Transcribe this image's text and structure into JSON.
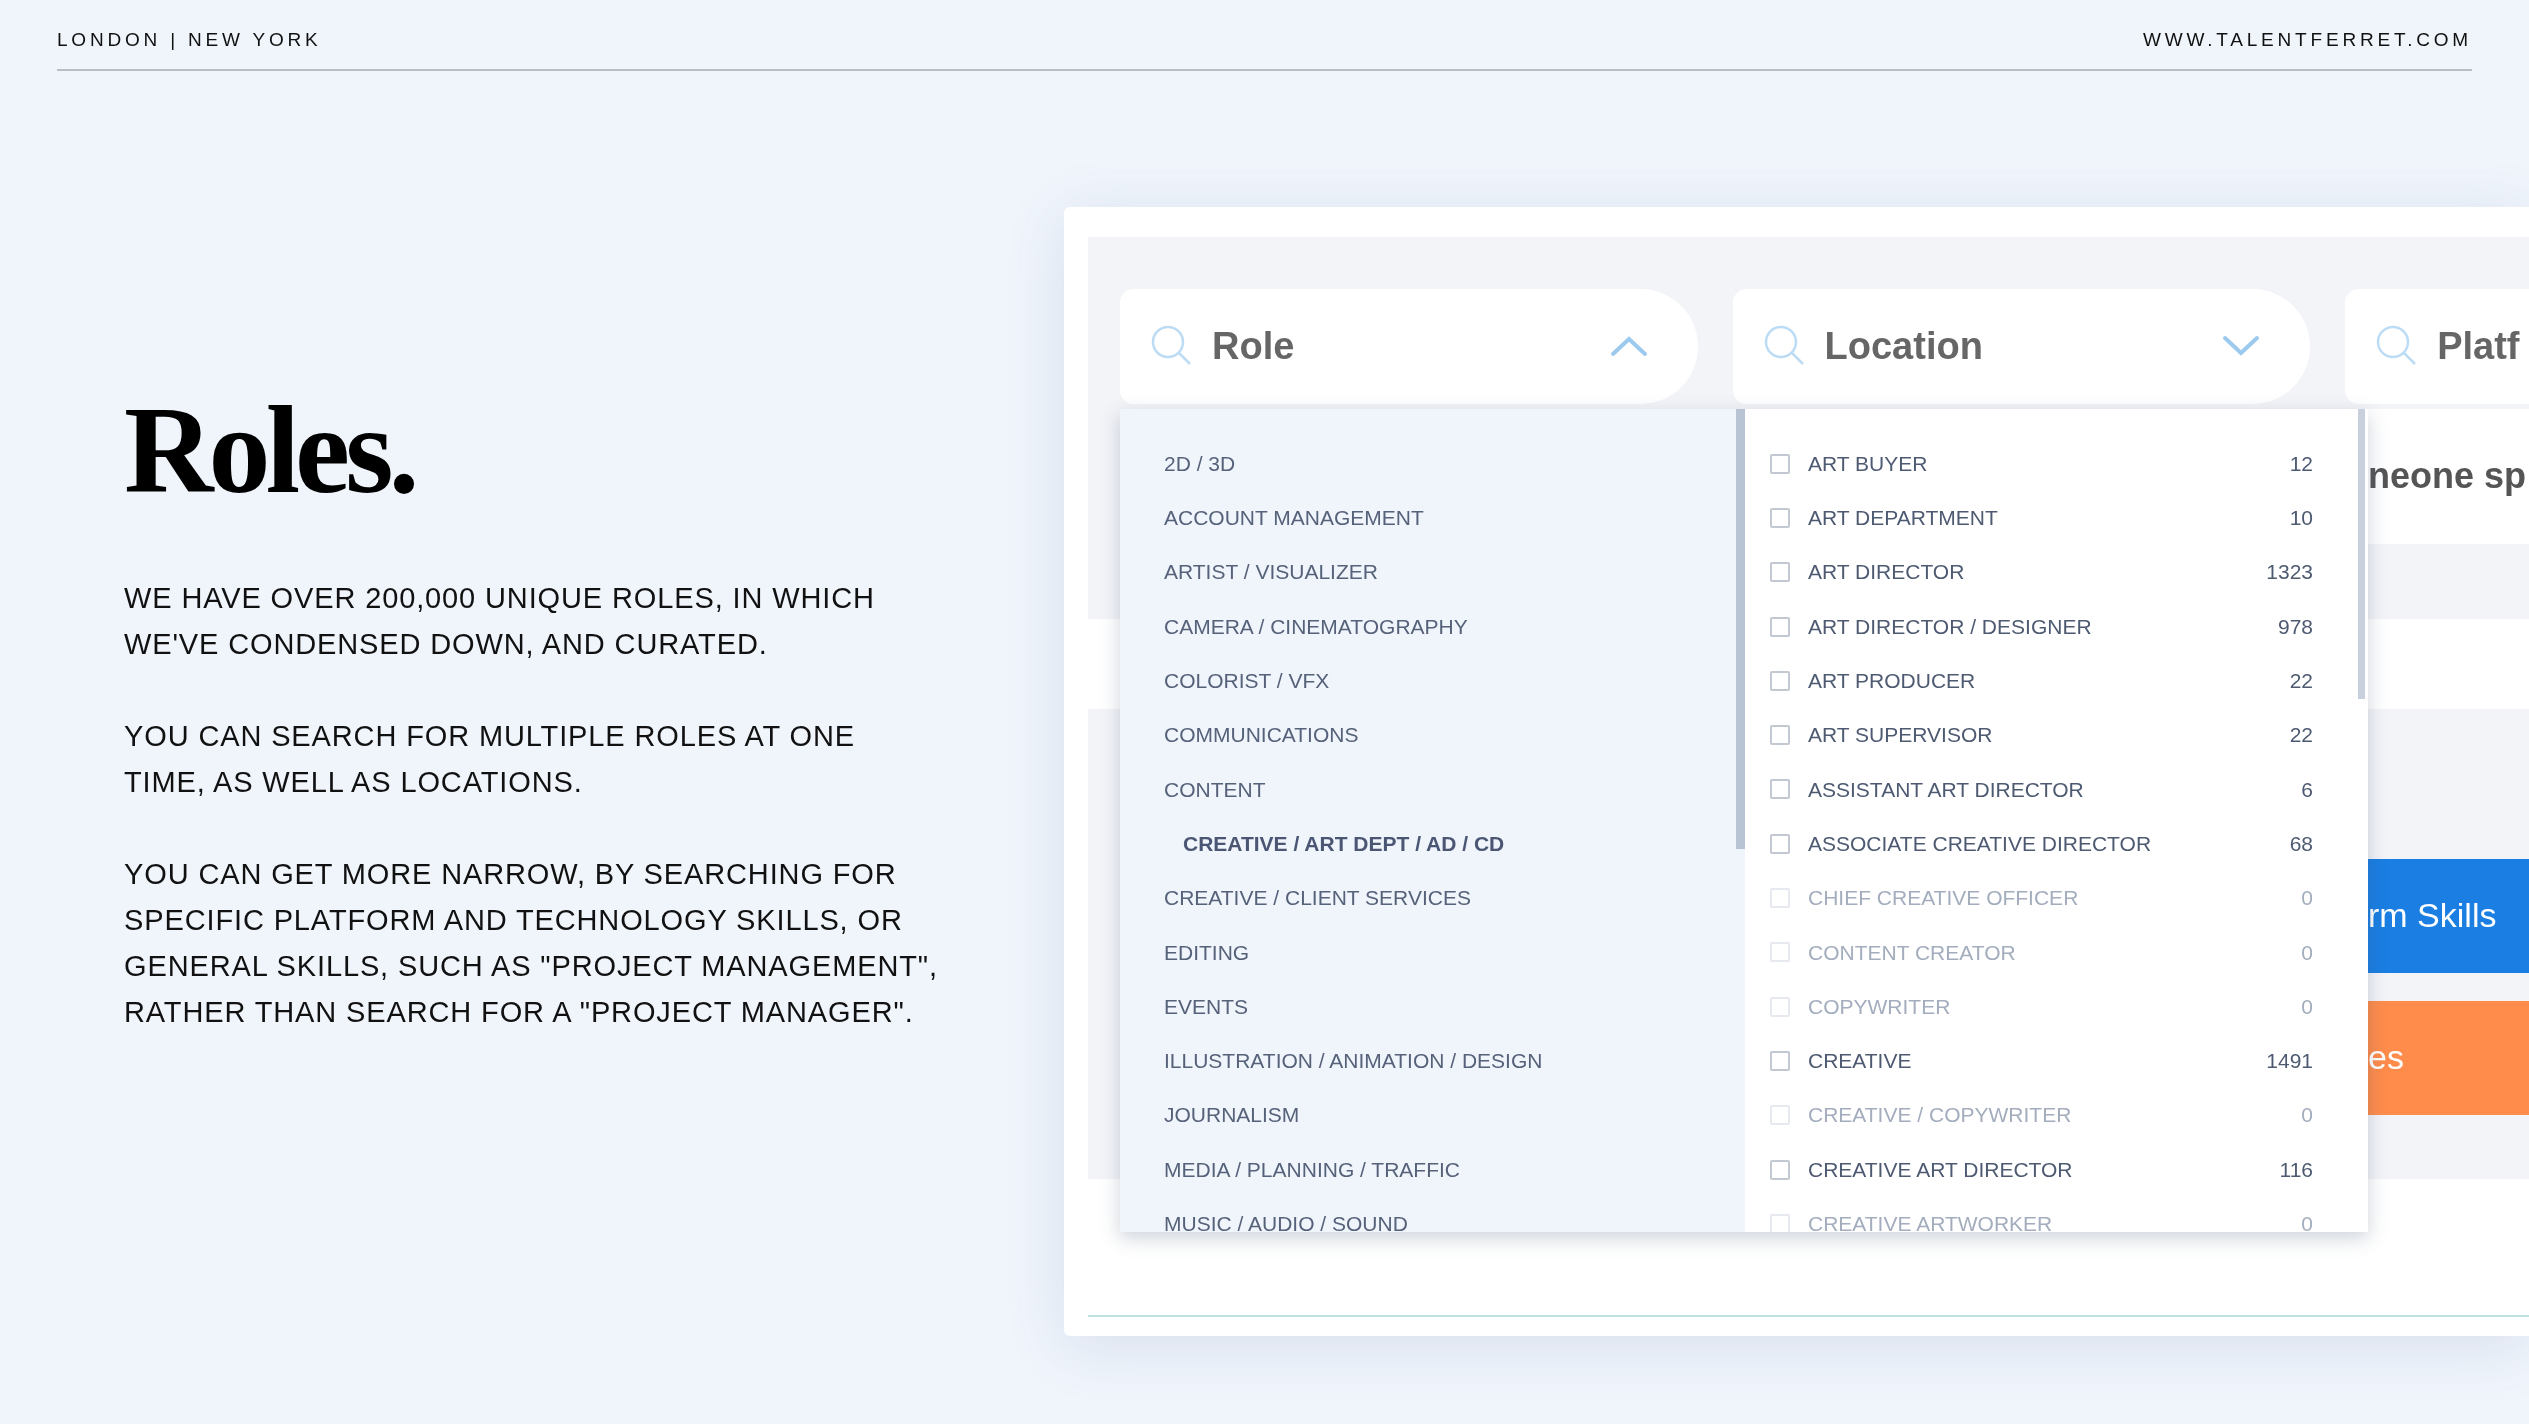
{
  "header": {
    "offices": "LONDON | NEW YORK",
    "website": "WWW.TALENTFERRET.COM"
  },
  "title": "Roles.",
  "paragraphs": [
    "WE HAVE OVER 200,000 UNIQUE ROLES, IN WHICH WE'VE CONDENSED DOWN, AND CURATED.",
    "YOU CAN SEARCH FOR MULTIPLE ROLES AT ONE TIME, AS WELL AS LOCATIONS.",
    "YOU CAN GET MORE NARROW, BY SEARCHING FOR SPECIFIC PLATFORM AND TECHNOLOGY SKILLS, OR GENERAL SKILLS, SUCH AS \"PROJECT MANAGEMENT\", RATHER THAN SEARCH FOR A \"PROJECT MANAGER\"."
  ],
  "screenshot": {
    "filters": [
      {
        "label": "Role",
        "kind": "dropdown",
        "expanded": true
      },
      {
        "label": "Location",
        "kind": "dropdown",
        "expanded": false
      },
      {
        "label": "Platf",
        "kind": "plain"
      }
    ],
    "role_groups": [
      {
        "label": "2D / 3D",
        "selected": false
      },
      {
        "label": "ACCOUNT MANAGEMENT",
        "selected": false
      },
      {
        "label": "ARTIST / VISUALIZER",
        "selected": false
      },
      {
        "label": "CAMERA / CINEMATOGRAPHY",
        "selected": false
      },
      {
        "label": "COLORIST / VFX",
        "selected": false
      },
      {
        "label": "COMMUNICATIONS",
        "selected": false
      },
      {
        "label": "CONTENT",
        "selected": false
      },
      {
        "label": "CREATIVE / ART DEPT / AD / CD",
        "selected": true
      },
      {
        "label": "CREATIVE / CLIENT SERVICES",
        "selected": false
      },
      {
        "label": "EDITING",
        "selected": false
      },
      {
        "label": "EVENTS",
        "selected": false
      },
      {
        "label": "ILLUSTRATION / ANIMATION / DESIGN",
        "selected": false
      },
      {
        "label": "JOURNALISM",
        "selected": false
      },
      {
        "label": "MEDIA / PLANNING / TRAFFIC",
        "selected": false
      },
      {
        "label": "MUSIC / AUDIO / SOUND",
        "selected": false
      }
    ],
    "role_options": [
      {
        "label": "ART BUYER",
        "count": "12",
        "checked": false,
        "disabled": false
      },
      {
        "label": "ART DEPARTMENT",
        "count": "10",
        "checked": false,
        "disabled": false
      },
      {
        "label": "ART DIRECTOR",
        "count": "1323",
        "checked": false,
        "disabled": false
      },
      {
        "label": "ART DIRECTOR / DESIGNER",
        "count": "978",
        "checked": false,
        "disabled": false
      },
      {
        "label": "ART PRODUCER",
        "count": "22",
        "checked": false,
        "disabled": false
      },
      {
        "label": "ART SUPERVISOR",
        "count": "22",
        "checked": false,
        "disabled": false
      },
      {
        "label": "ASSISTANT ART DIRECTOR",
        "count": "6",
        "checked": false,
        "disabled": false
      },
      {
        "label": "ASSOCIATE CREATIVE DIRECTOR",
        "count": "68",
        "checked": false,
        "disabled": false
      },
      {
        "label": "CHIEF CREATIVE OFFICER",
        "count": "0",
        "checked": false,
        "disabled": true
      },
      {
        "label": "CONTENT CREATOR",
        "count": "0",
        "checked": false,
        "disabled": true
      },
      {
        "label": "COPYWRITER",
        "count": "0",
        "checked": false,
        "disabled": true
      },
      {
        "label": "CREATIVE",
        "count": "1491",
        "checked": false,
        "disabled": false
      },
      {
        "label": "CREATIVE / COPYWRITER",
        "count": "0",
        "checked": false,
        "disabled": true
      },
      {
        "label": "CREATIVE ART DIRECTOR",
        "count": "116",
        "checked": false,
        "disabled": false
      },
      {
        "label": "CREATIVE ARTWORKER",
        "count": "0",
        "checked": false,
        "disabled": true
      }
    ],
    "search_text": "neone sp",
    "buttons": [
      {
        "label": "rm Skills",
        "color": "#1a7ee2"
      },
      {
        "label": "es",
        "color": "#ff8c4b"
      }
    ]
  }
}
